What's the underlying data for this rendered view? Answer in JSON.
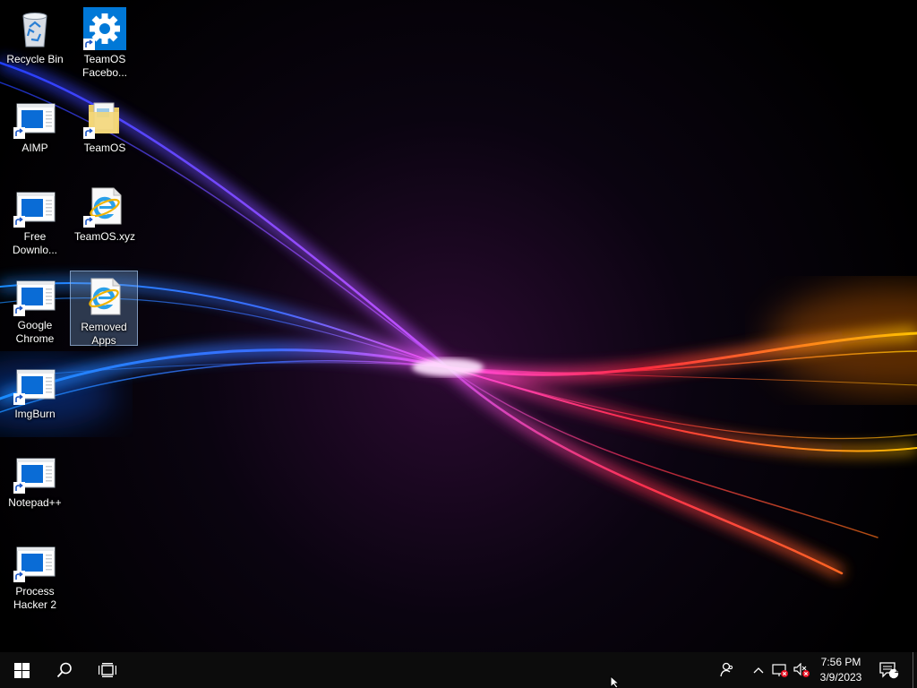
{
  "desktop": {
    "icons": [
      {
        "label": "Recycle Bin",
        "icon": "recycle-bin-icon"
      },
      {
        "label": "TeamOS\nFacebo...",
        "icon": "settings-gear-icon"
      },
      {
        "label": "AIMP",
        "icon": "app-window-icon"
      },
      {
        "label": "TeamOS",
        "icon": "folder-icon"
      },
      {
        "label": "Free\nDownlo...",
        "icon": "app-window-icon"
      },
      {
        "label": "TeamOS.xyz",
        "icon": "internet-explorer-icon"
      },
      {
        "label": "Google\nChrome",
        "icon": "app-window-icon"
      },
      {
        "label": "Removed\nApps",
        "icon": "internet-explorer-icon",
        "selected": true
      },
      {
        "label": "ImgBurn",
        "icon": "app-window-icon"
      },
      {
        "label": "Notepad++",
        "icon": "app-window-icon"
      },
      {
        "label": "Process\nHacker 2",
        "icon": "app-window-icon"
      }
    ]
  },
  "taskbar": {
    "start": "windows-start-icon",
    "search": "search-icon",
    "task_view": "task-view-icon",
    "tray": [
      "people-icon",
      "show-hidden-icons-chevron",
      "network-disconnected-icon",
      "volume-muted-icon"
    ],
    "clock": {
      "time": "7:56 PM",
      "date": "3/9/2023"
    },
    "notifications": {
      "count": "1"
    }
  },
  "colors": {
    "taskbar": "#0c0c0c",
    "accent_blue": "#0078d7",
    "selection": "#78a0d2"
  }
}
